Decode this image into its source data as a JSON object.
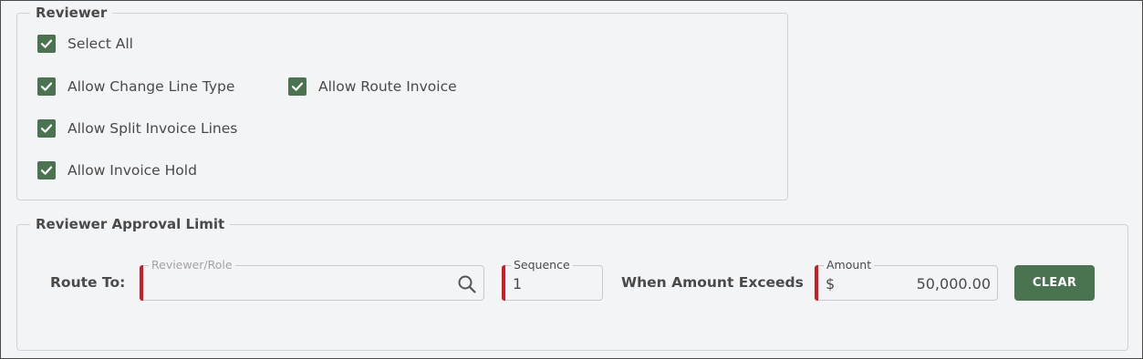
{
  "reviewer": {
    "legend": "Reviewer",
    "select_all": {
      "label": "Select All",
      "checked": true
    },
    "options": [
      {
        "label": "Allow Change Line Type",
        "checked": true
      },
      {
        "label": "Allow Route Invoice",
        "checked": true
      },
      {
        "label": "Allow Split Invoice Lines",
        "checked": true
      },
      {
        "label": "Allow Invoice Hold",
        "checked": true
      }
    ]
  },
  "approval_limit": {
    "legend": "Reviewer Approval Limit",
    "route_to_label": "Route To:",
    "reviewer_role": {
      "label": "Reviewer/Role",
      "value": ""
    },
    "sequence": {
      "label": "Sequence",
      "value": "1"
    },
    "when_amount_exceeds_label": "When Amount Exceeds",
    "amount": {
      "label": "Amount",
      "currency": "$",
      "value": "50,000.00"
    },
    "clear_label": "CLEAR"
  },
  "colors": {
    "accent_green": "#4a7350",
    "required_red": "#d41920",
    "background": "#f3f4f6",
    "border": "#cfd2d6"
  },
  "icons": {
    "checkbox_check": "check-icon",
    "lookup": "search-icon"
  }
}
